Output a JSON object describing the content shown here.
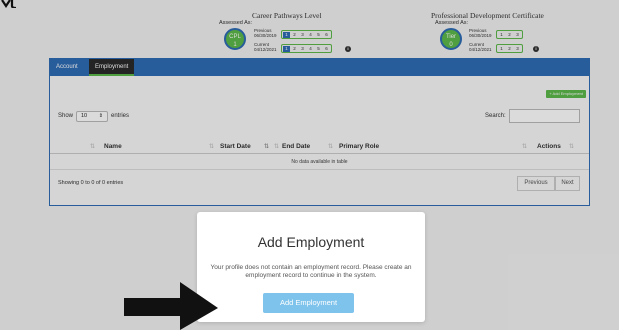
{
  "header": {
    "career": {
      "title": "Career Pathways Level",
      "assessed_label": "Assessed As:",
      "badge_line1": "CPL",
      "badge_line2": "1",
      "previous_label": "Previous",
      "previous_date": "06/30/2019",
      "current_label": "Current",
      "current_date": "04/12/2021",
      "scale": [
        "1",
        "2",
        "3",
        "4",
        "5",
        "6"
      ],
      "previous_level": "1",
      "current_level": "1"
    },
    "pdc": {
      "title": "Professional Development Certificate",
      "assessed_label": "Assessed As:",
      "badge_line1": "Tier",
      "badge_line2": "0",
      "previous_label": "Previous",
      "previous_date": "06/30/2019",
      "current_label": "Current",
      "current_date": "04/12/2021",
      "scale": [
        "1",
        "2",
        "3"
      ]
    }
  },
  "tabs": [
    {
      "label": "Account",
      "active": false
    },
    {
      "label": "Employment",
      "active": true
    }
  ],
  "table": {
    "add_button": "+ Add Employment",
    "show_label": "Show",
    "entries_value": "10",
    "entries_label": "entries",
    "search_label": "Search:",
    "columns": [
      "Name",
      "Start Date",
      "End Date",
      "Primary Role",
      "Actions"
    ],
    "empty_message": "No data available in table",
    "info": "Showing 0 to 0 of 0 entries",
    "prev_label": "Previous",
    "next_label": "Next"
  },
  "modal": {
    "title": "Add Employment",
    "message": "Your profile does not contain an employment record. Please create an employment record to continue in the system.",
    "button_label": "Add Employment"
  },
  "colors": {
    "primary_blue": "#2f6db5",
    "accent_green": "#5cb84a",
    "modal_button": "#7ec3ec"
  }
}
